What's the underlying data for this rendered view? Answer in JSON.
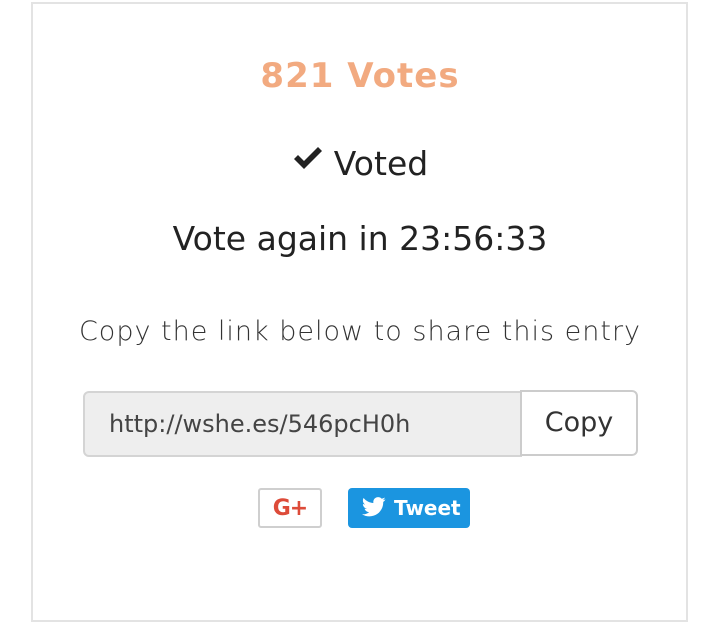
{
  "vote_count_text": "821 Votes",
  "status": {
    "icon": "checkmark-icon",
    "label": "Voted"
  },
  "countdown_text": "Vote again in 23:56:33",
  "share": {
    "label": "Copy the link below to share this entry",
    "link_value": "http://wshe.es/546pcH0h",
    "copy_label": "Copy"
  },
  "social": {
    "gplus_label": "G+",
    "gplus_icon": "google-plus-icon",
    "tweet_label": "Tweet",
    "tweet_icon": "twitter-bird-icon"
  },
  "colors": {
    "votes_accent": "#f2aa80",
    "twitter_blue": "#1b95e0",
    "google_red": "#dd4b39"
  }
}
